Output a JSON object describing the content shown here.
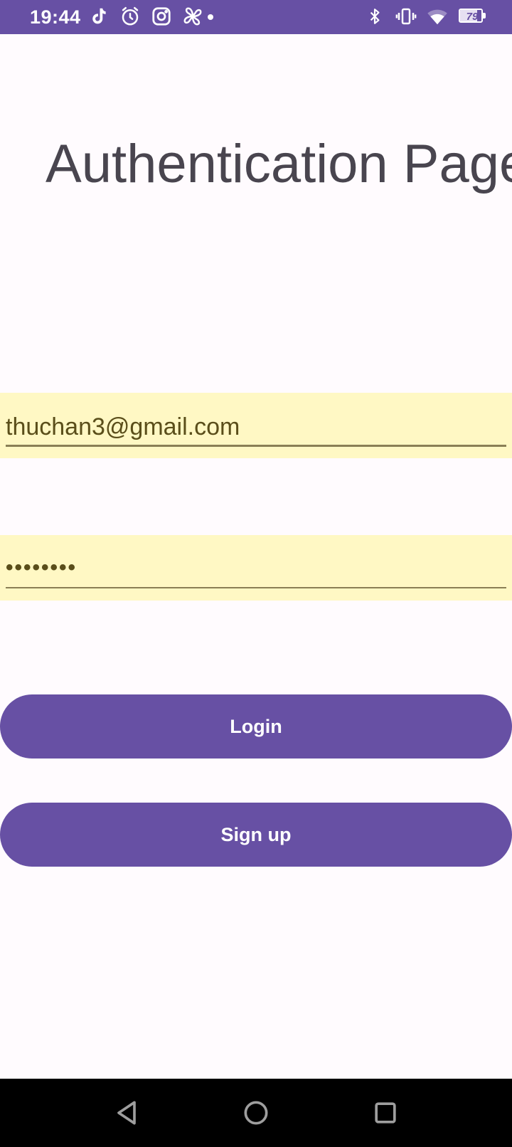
{
  "status_bar": {
    "time": "19:44",
    "battery_level": "79",
    "battery_percent": 79,
    "background_color": "#6750A4",
    "left_icons": [
      "tiktok-icon",
      "alarm-icon",
      "instagram-icon",
      "pinwheel-icon",
      "notification-dot"
    ],
    "right_icons": [
      "bluetooth-icon",
      "vibrate-icon",
      "wifi-icon",
      "battery-icon"
    ]
  },
  "page": {
    "title": "Authentication Page"
  },
  "form": {
    "email_value": "thuchan3@gmail.com",
    "password_value": "••••••••",
    "field_background_color": "#FFF8C4"
  },
  "buttons": {
    "login_label": "Login",
    "signup_label": "Sign up",
    "button_color": "#6750A4"
  },
  "nav_bar": {
    "icons": [
      "back-icon",
      "home-icon",
      "recents-icon"
    ]
  }
}
